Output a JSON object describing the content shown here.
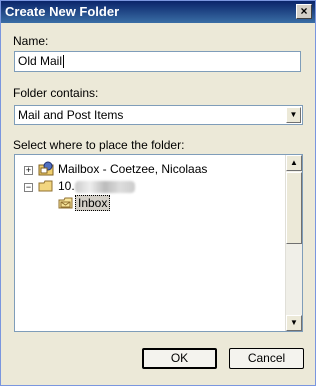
{
  "window": {
    "title": "Create New Folder",
    "close_glyph": "×"
  },
  "name": {
    "label": "Name:",
    "value": "Old Mail"
  },
  "contains": {
    "label": "Folder contains:",
    "value": "Mail and Post Items"
  },
  "location": {
    "label": "Select where to place the folder:",
    "items": [
      {
        "label": "Mailbox - Coetzee, Nicolaas",
        "expander": "+",
        "icon": "mailbox-icon"
      },
      {
        "label": "10.",
        "expander": "−",
        "icon": "folder-icon"
      },
      {
        "label": "Inbox",
        "icon": "inbox-folder-icon",
        "selected": true
      }
    ]
  },
  "buttons": {
    "ok": "OK",
    "cancel": "Cancel"
  }
}
